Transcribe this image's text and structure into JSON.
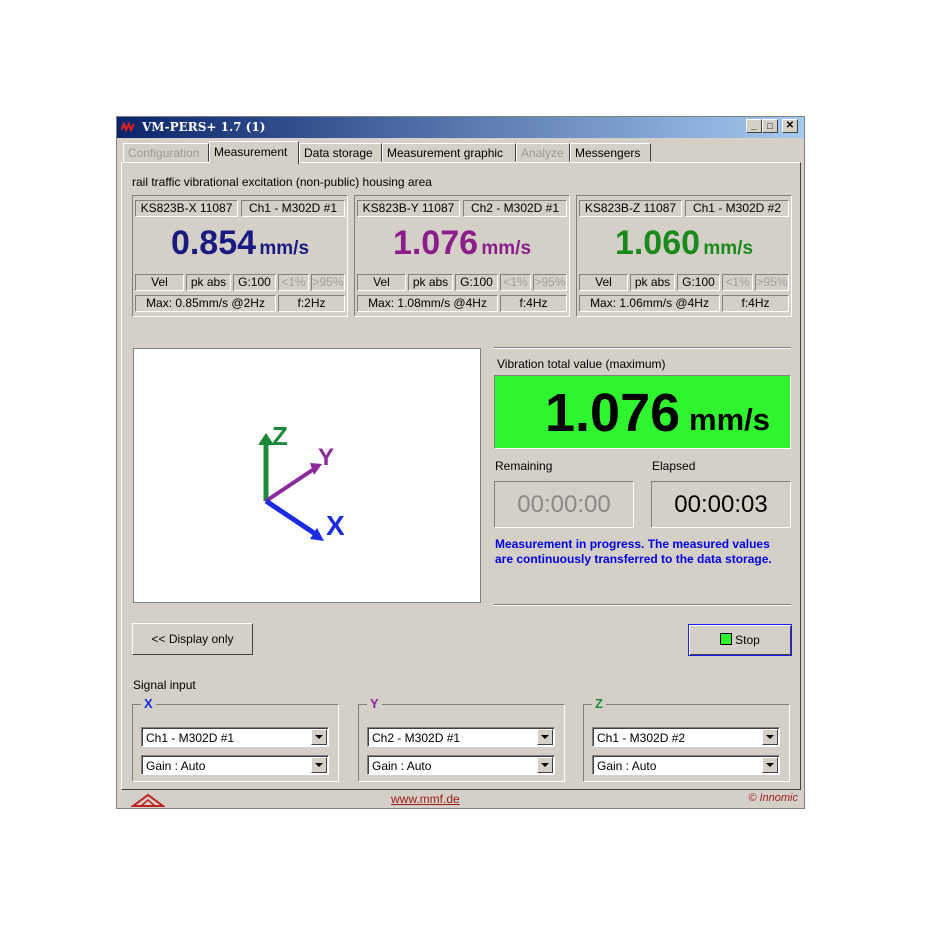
{
  "window": {
    "title": "VM-PERS+ 1.7 (1)",
    "minimize": "_",
    "maximize": "□",
    "close": "✕"
  },
  "tabs": [
    {
      "label": "Configuration",
      "state": "disabled"
    },
    {
      "label": "Measurement",
      "state": "active"
    },
    {
      "label": "Data storage",
      "state": "normal"
    },
    {
      "label": "Measurement graphic",
      "state": "normal"
    },
    {
      "label": "Analyze",
      "state": "disabled"
    },
    {
      "label": "Messengers",
      "state": "normal"
    }
  ],
  "subtitle": "rail traffic vibrational excitation (non-public) housing area",
  "sensors": [
    {
      "sensor": "KS823B-X 11087",
      "channel": "Ch1 - M302D #1",
      "value": "0.854",
      "unit": "mm/s",
      "color": "#1a1a80",
      "mode": "Vel",
      "peak": "pk abs",
      "gain": "G:100",
      "lo": "<1%",
      "hi": ">95%",
      "max": "Max: 0.85mm/s @2Hz",
      "freq": "f:2Hz"
    },
    {
      "sensor": "KS823B-Y 11087",
      "channel": "Ch2 - M302D #1",
      "value": "1.076",
      "unit": "mm/s",
      "color": "#8b1e8b",
      "mode": "Vel",
      "peak": "pk abs",
      "gain": "G:100",
      "lo": "<1%",
      "hi": ">95%",
      "max": "Max: 1.08mm/s @4Hz",
      "freq": "f:4Hz"
    },
    {
      "sensor": "KS823B-Z 11087",
      "channel": "Ch1 - M302D #2",
      "value": "1.060",
      "unit": "mm/s",
      "color": "#1a8a1a",
      "mode": "Vel",
      "peak": "pk abs",
      "gain": "G:100",
      "lo": "<1%",
      "hi": ">95%",
      "max": "Max: 1.06mm/s @4Hz",
      "freq": "f:4Hz"
    }
  ],
  "axes": {
    "x": "X",
    "y": "Y",
    "z": "Z",
    "x_color": "#1a2be0",
    "y_color": "#8b2a9b",
    "z_color": "#1a8a3a"
  },
  "total": {
    "label": "Vibration total value (maximum)",
    "value": "1.076",
    "unit": "mm/s",
    "bg": "#2ef52e"
  },
  "timers": {
    "remaining_label": "Remaining",
    "remaining": "00:00:00",
    "elapsed_label": "Elapsed",
    "elapsed": "00:00:03"
  },
  "status_message": "Measurement in progress. The measured values are continuously transferred to the data storage.",
  "buttons": {
    "display_only": "<< Display only",
    "stop": "Stop"
  },
  "signal_input": {
    "label": "Signal input",
    "groups": [
      {
        "axis": "X",
        "channel": "Ch1 - M302D #1",
        "gain": "Gain : Auto",
        "color": "#1a2be0"
      },
      {
        "axis": "Y",
        "channel": "Ch2 - M302D #1",
        "gain": "Gain : Auto",
        "color": "#8b2a9b"
      },
      {
        "axis": "Z",
        "channel": "Ch1 - M302D #2",
        "gain": "Gain : Auto",
        "color": "#1a8a3a"
      }
    ]
  },
  "footer": {
    "link": "www.mmf.de",
    "copyright": "© Innomic"
  }
}
